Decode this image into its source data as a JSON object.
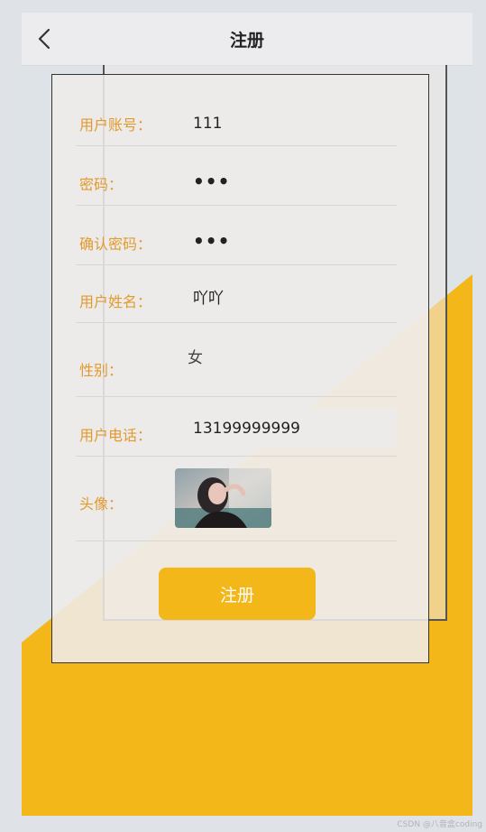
{
  "header": {
    "title": "注册"
  },
  "form": {
    "fields": [
      {
        "label": "用户账号：",
        "value": "111"
      },
      {
        "label": "密码：",
        "value": "•••"
      },
      {
        "label": "确认密码：",
        "value": "•••"
      },
      {
        "label": "用户姓名：",
        "value": "吖吖"
      },
      {
        "label": "性别：",
        "value": "女"
      },
      {
        "label": "用户电话：",
        "value": "13199999999"
      },
      {
        "label": "头像："
      }
    ],
    "submit_label": "注册"
  },
  "colors": {
    "accent": "#f3b719",
    "label": "#e29a2c",
    "background": "#dde3e7"
  },
  "watermark": "CSDN @八音盒coding"
}
